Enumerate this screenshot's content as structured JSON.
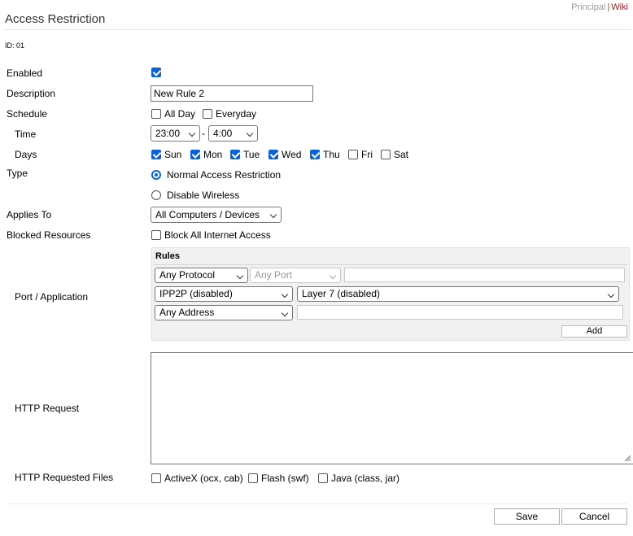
{
  "nav": {
    "principal": "Principal",
    "separator": "|",
    "wiki": "Wiki"
  },
  "title": "Access Restriction",
  "id_line": "ID: 01",
  "labels": {
    "enabled": "Enabled",
    "description": "Description",
    "schedule": "Schedule",
    "time": "Time",
    "days": "Days",
    "type": "Type",
    "applies_to": "Applies To",
    "blocked_resources": "Blocked Resources",
    "port_application": "Port / Application",
    "http_request": "HTTP Request",
    "http_requested_files": "HTTP Requested Files"
  },
  "form": {
    "enabled": true,
    "description_value": "New Rule 2",
    "schedule": {
      "all_day": "All Day",
      "all_day_checked": false,
      "everyday": "Everyday",
      "everyday_checked": false
    },
    "time": {
      "start": "23:00",
      "separator": "-",
      "end": "4:00"
    },
    "days": [
      {
        "label": "Sun",
        "checked": true
      },
      {
        "label": "Mon",
        "checked": true
      },
      {
        "label": "Tue",
        "checked": true
      },
      {
        "label": "Wed",
        "checked": true
      },
      {
        "label": "Thu",
        "checked": true
      },
      {
        "label": "Fri",
        "checked": false
      },
      {
        "label": "Sat",
        "checked": false
      }
    ],
    "type_options": [
      {
        "label": "Normal Access Restriction",
        "selected": true
      },
      {
        "label": "Disable Wireless",
        "selected": false
      }
    ],
    "applies_to": "All Computers / Devices",
    "block_all": {
      "label": "Block All Internet Access",
      "checked": false
    }
  },
  "rules": {
    "title": "Rules",
    "protocol": "Any Protocol",
    "port": "Any Port",
    "ipp2p": "IPP2P (disabled)",
    "layer7": "Layer 7 (disabled)",
    "address": "Any Address",
    "add_label": "Add"
  },
  "files": [
    {
      "label": "ActiveX (ocx, cab)",
      "checked": false
    },
    {
      "label": "Flash (swf)",
      "checked": false
    },
    {
      "label": "Java (class, jar)",
      "checked": false
    }
  ],
  "buttons": {
    "save": "Save",
    "cancel": "Cancel"
  },
  "colors": {
    "accent": "#0a62d6",
    "wiki_link": "#b5131b",
    "muted": "#999999"
  }
}
